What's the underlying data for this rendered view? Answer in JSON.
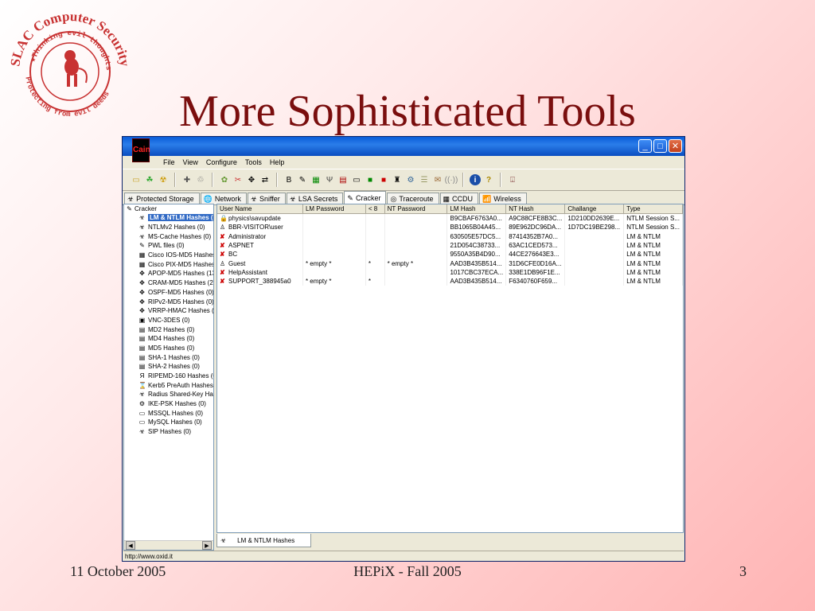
{
  "slide": {
    "title": "More Sophisticated Tools",
    "logo_top_text": "SLAC Computer Security",
    "logo_inner_top": "Thinking evil thoughts",
    "logo_inner_bottom": "Protecting from evil deeds",
    "footer_date": "11 October 2005",
    "footer_event": "HEPiX - Fall 2005",
    "footer_page": "3"
  },
  "window": {
    "menu": [
      "File",
      "View",
      "Configure",
      "Tools",
      "Help"
    ],
    "tabs": [
      {
        "label": "Protected Storage",
        "icon": "☣"
      },
      {
        "label": "Network",
        "icon": "🌐"
      },
      {
        "label": "Sniffer",
        "icon": "☣"
      },
      {
        "label": "LSA Secrets",
        "icon": "☣"
      },
      {
        "label": "Cracker",
        "icon": "✎"
      },
      {
        "label": "Traceroute",
        "icon": "◎"
      },
      {
        "label": "CCDU",
        "icon": "▦"
      },
      {
        "label": "Wireless",
        "icon": "📶"
      }
    ],
    "tree_root": "Cracker",
    "tree_items": [
      "LM & NTLM Hashes (",
      "NTLMv2 Hashes (0)",
      "MS-Cache Hashes (0)",
      "PWL files (0)",
      "Cisco IOS-MD5 Hashes",
      "Cisco PIX-MD5 Hashes",
      "APOP-MD5 Hashes (13",
      "CRAM-MD5 Hashes (2)",
      "OSPF-MD5 Hashes (0)",
      "RIPv2-MD5 Hashes (0)",
      "VRRP-HMAC Hashes (0",
      "VNC-3DES (0)",
      "MD2 Hashes (0)",
      "MD4 Hashes (0)",
      "MD5 Hashes (0)",
      "SHA-1 Hashes (0)",
      "SHA-2 Hashes (0)",
      "RIPEMD-160 Hashes (0",
      "Kerb5 PreAuth Hashes",
      "Radius Shared-Key Has",
      "IKE-PSK Hashes (0)",
      "MSSQL Hashes (0)",
      "MySQL Hashes (0)",
      "SIP Hashes (0)"
    ],
    "columns": [
      "User Name",
      "LM Password",
      "< 8",
      "NT Password",
      "LM Hash",
      "NT Hash",
      "Challange",
      "Type"
    ],
    "rows": [
      {
        "icon": "lock",
        "cells": [
          "physics\\savupdate",
          "",
          "",
          "",
          "B9CBAF6763A0...",
          "A9C88CFE8B3C...",
          "1D210DD2639E...",
          "NTLM Session S..."
        ]
      },
      {
        "icon": "user",
        "cells": [
          "BBR-VISITOR\\user",
          "",
          "",
          "",
          "BB1065B04A45...",
          "89E962DC96DA...",
          "1D7DC19BE298...",
          "NTLM Session S..."
        ]
      },
      {
        "icon": "x",
        "cells": [
          "Administrator",
          "",
          "",
          "",
          "630505E57DC5...",
          "87414352B7A0...",
          "",
          "LM & NTLM"
        ]
      },
      {
        "icon": "x",
        "cells": [
          "ASPNET",
          "",
          "",
          "",
          "21D054C38733...",
          "63AC1CED573...",
          "",
          "LM & NTLM"
        ]
      },
      {
        "icon": "x",
        "cells": [
          "BC",
          "",
          "",
          "",
          "9550A35B4D90...",
          "44CE276643E3...",
          "",
          "LM & NTLM"
        ]
      },
      {
        "icon": "user",
        "cells": [
          "Guest",
          "* empty *",
          "*",
          "* empty *",
          "AAD3B435B514...",
          "31D6CFE0D16A...",
          "",
          "LM & NTLM"
        ]
      },
      {
        "icon": "x",
        "cells": [
          "HelpAssistant",
          "",
          "",
          "",
          "1017CBC37ECA...",
          "338E1DB96F1E...",
          "",
          "LM & NTLM"
        ]
      },
      {
        "icon": "x",
        "cells": [
          "SUPPORT_388945a0",
          "* empty *",
          "*",
          "",
          "AAD3B435B514...",
          "F6340760F659...",
          "",
          "LM & NTLM"
        ]
      }
    ],
    "bottom_tab": "LM & NTLM Hashes",
    "status": "http://www.oxid.it"
  }
}
